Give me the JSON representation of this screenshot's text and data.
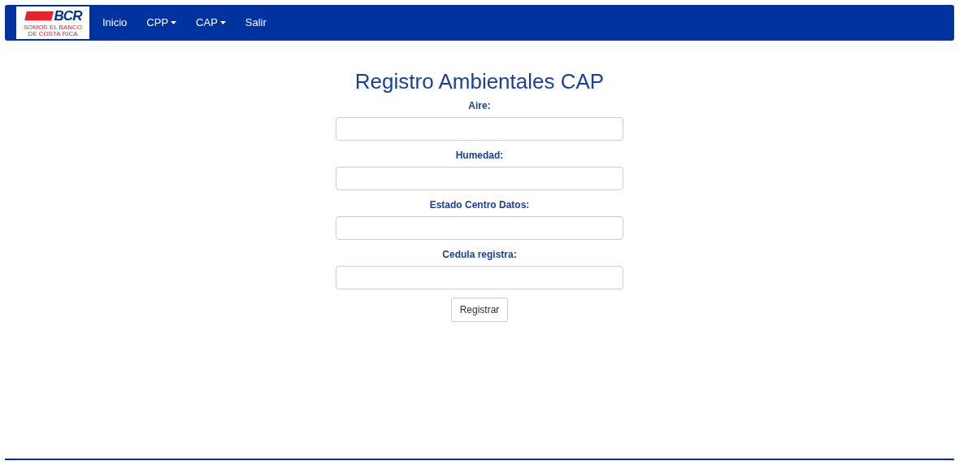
{
  "navbar": {
    "logo": {
      "text": "BCR",
      "tagline": "SOMOS EL BANCO DE COSTA RICA"
    },
    "items": [
      {
        "label": "Inicio",
        "kind": "link"
      },
      {
        "label": "CPP",
        "kind": "dropdown"
      },
      {
        "label": "CAP",
        "kind": "dropdown"
      },
      {
        "label": "Salir",
        "kind": "link"
      }
    ]
  },
  "form": {
    "title": "Registro Ambientales CAP",
    "fields": [
      {
        "label": "Aire:"
      },
      {
        "label": "Humedad:"
      },
      {
        "label": "Estado Centro Datos:"
      },
      {
        "label": "Cedula registra:"
      }
    ],
    "submit": "Registrar"
  }
}
